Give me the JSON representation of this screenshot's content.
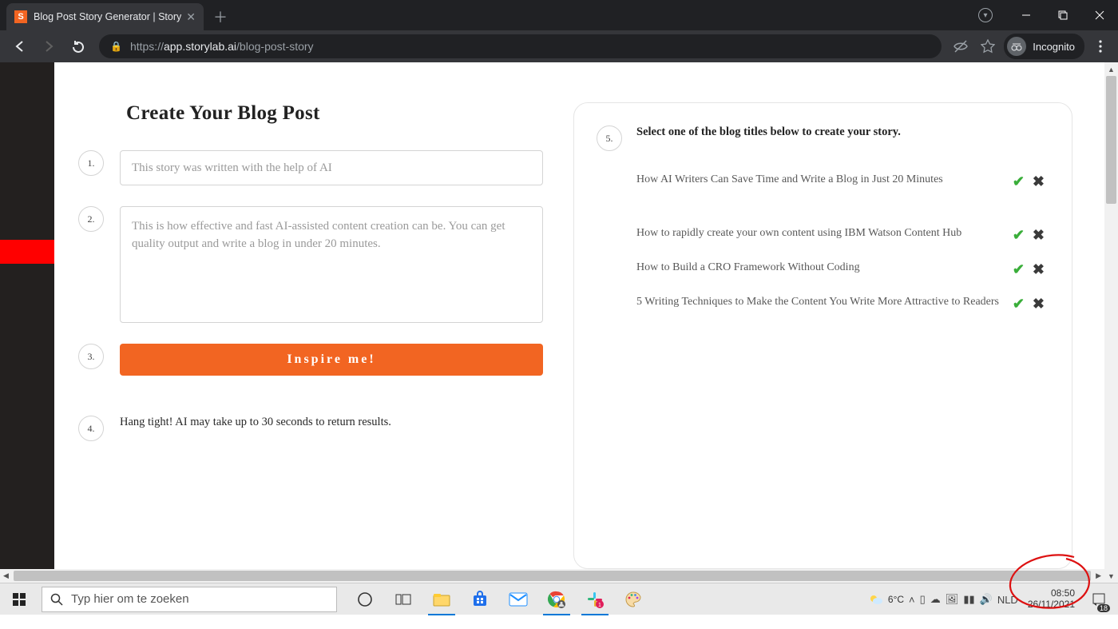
{
  "browser": {
    "tab_title": "Blog Post Story Generator | Story",
    "url_secure_host": "app.storylab.ai",
    "url_prefix": "https://",
    "url_path": "/blog-post-story",
    "incognito_label": "Incognito"
  },
  "page": {
    "heading": "Create Your Blog Post",
    "step1_num": "1.",
    "step1_text": "This story was written with the help of AI",
    "step2_num": "2.",
    "step2_text": "This is how effective and fast AI-assisted content creation can be. You can get quality output and write a blog in under 20 minutes.",
    "step3_num": "3.",
    "inspire_label": "Inspire me!",
    "step4_num": "4.",
    "step4_text": "Hang tight! AI may take up to 30 seconds to return results.",
    "step5_num": "5.",
    "step5_instruction": "Select one of the blog titles below to create your story.",
    "suggestions": [
      " How AI Writers Can Save Time and Write a Blog in Just 20 Minutes",
      " How to rapidly create your own content using IBM Watson Content Hub",
      " How to Build a CRO Framework Without Coding",
      " 5 Writing Techniques to Make the Content You Write More Attractive to Readers"
    ]
  },
  "taskbar": {
    "search_placeholder": "Typ hier om te zoeken",
    "temp": "6°C",
    "lang": "NLD",
    "time": "08:50",
    "date": "26/11/2021",
    "notif_count": "18"
  }
}
